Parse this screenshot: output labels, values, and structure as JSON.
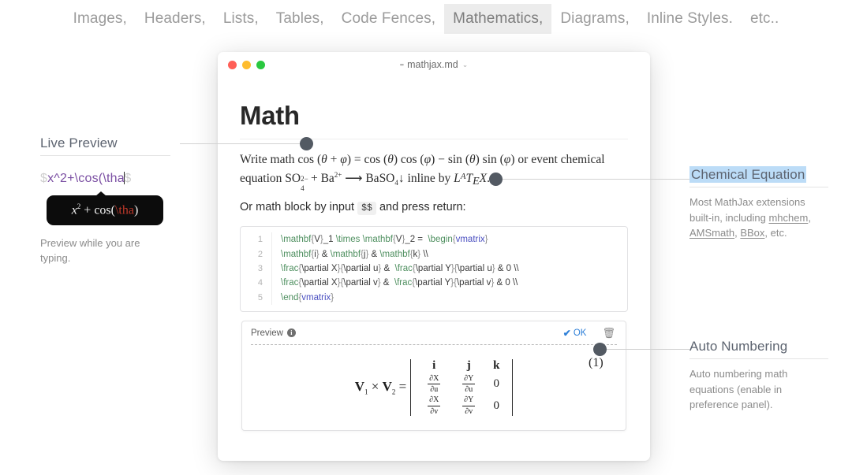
{
  "topnav": {
    "items": [
      {
        "label": "Images,",
        "active": false
      },
      {
        "label": "Headers,",
        "active": false
      },
      {
        "label": "Lists,",
        "active": false
      },
      {
        "label": "Tables,",
        "active": false
      },
      {
        "label": "Code Fences,",
        "active": false
      },
      {
        "label": "Mathematics,",
        "active": true
      },
      {
        "label": "Diagrams,",
        "active": false
      },
      {
        "label": "Inline Styles.",
        "active": false
      },
      {
        "label": "etc..",
        "active": false
      }
    ]
  },
  "window": {
    "filename": "mathjax.md",
    "file_icon": "markdown-file-icon",
    "caret_glyph": "⌄",
    "traffic_lights": [
      "close-red",
      "minimize-yellow",
      "zoom-green"
    ]
  },
  "document": {
    "heading": "Math",
    "paragraph1": {
      "lead": "Write math",
      "formula1": "cos (θ + φ) = cos (θ) cos (φ) − sin (θ) sin (φ)",
      "mid": "or event chemical equation",
      "formula2": "SO4^2- + Ba^2+ ⟶ BaSO4↓",
      "tail_a": "inline by",
      "latex": "LaTeX",
      "tail_b": "."
    },
    "paragraph2": {
      "pre": "Or math block by input",
      "badge": "$$",
      "post": "and press return:"
    },
    "code_block": {
      "language": "latex",
      "lines": [
        {
          "n": "1",
          "tokens": [
            {
              "t": "\\mathbf",
              "k": "cmd"
            },
            {
              "t": "{",
              "k": "pun"
            },
            {
              "t": "V",
              "k": "txt"
            },
            {
              "t": "}",
              "k": "pun"
            },
            {
              "t": "_1 ",
              "k": "txt"
            },
            {
              "t": "\\times",
              "k": "cmd"
            },
            {
              "t": " ",
              "k": "txt"
            },
            {
              "t": "\\mathbf",
              "k": "cmd"
            },
            {
              "t": "{",
              "k": "pun"
            },
            {
              "t": "V",
              "k": "txt"
            },
            {
              "t": "}",
              "k": "pun"
            },
            {
              "t": "_2 =  ",
              "k": "txt"
            },
            {
              "t": "\\begin",
              "k": "cmd"
            },
            {
              "t": "{",
              "k": "pun"
            },
            {
              "t": "vmatrix",
              "k": "arg"
            },
            {
              "t": "}",
              "k": "pun"
            }
          ]
        },
        {
          "n": "2",
          "tokens": [
            {
              "t": "\\mathbf",
              "k": "cmd"
            },
            {
              "t": "{",
              "k": "pun"
            },
            {
              "t": "i",
              "k": "txt"
            },
            {
              "t": "}",
              "k": "pun"
            },
            {
              "t": " & ",
              "k": "txt"
            },
            {
              "t": "\\mathbf",
              "k": "cmd"
            },
            {
              "t": "{",
              "k": "pun"
            },
            {
              "t": "j",
              "k": "txt"
            },
            {
              "t": "}",
              "k": "pun"
            },
            {
              "t": " & ",
              "k": "txt"
            },
            {
              "t": "\\mathbf",
              "k": "cmd"
            },
            {
              "t": "{",
              "k": "pun"
            },
            {
              "t": "k",
              "k": "txt"
            },
            {
              "t": "}",
              "k": "pun"
            },
            {
              "t": " \\\\",
              "k": "txt"
            }
          ]
        },
        {
          "n": "3",
          "tokens": [
            {
              "t": "\\frac",
              "k": "cmd"
            },
            {
              "t": "{",
              "k": "pun"
            },
            {
              "t": "\\partial X",
              "k": "txt"
            },
            {
              "t": "}",
              "k": "pun"
            },
            {
              "t": "{",
              "k": "pun"
            },
            {
              "t": "\\partial u",
              "k": "txt"
            },
            {
              "t": "}",
              "k": "pun"
            },
            {
              "t": " &  ",
              "k": "txt"
            },
            {
              "t": "\\frac",
              "k": "cmd"
            },
            {
              "t": "{",
              "k": "pun"
            },
            {
              "t": "\\partial Y",
              "k": "txt"
            },
            {
              "t": "}",
              "k": "pun"
            },
            {
              "t": "{",
              "k": "pun"
            },
            {
              "t": "\\partial u",
              "k": "txt"
            },
            {
              "t": "}",
              "k": "pun"
            },
            {
              "t": " & 0 \\\\",
              "k": "txt"
            }
          ]
        },
        {
          "n": "4",
          "tokens": [
            {
              "t": "\\frac",
              "k": "cmd"
            },
            {
              "t": "{",
              "k": "pun"
            },
            {
              "t": "\\partial X",
              "k": "txt"
            },
            {
              "t": "}",
              "k": "pun"
            },
            {
              "t": "{",
              "k": "pun"
            },
            {
              "t": "\\partial v",
              "k": "txt"
            },
            {
              "t": "}",
              "k": "pun"
            },
            {
              "t": " &  ",
              "k": "txt"
            },
            {
              "t": "\\frac",
              "k": "cmd"
            },
            {
              "t": "{",
              "k": "pun"
            },
            {
              "t": "\\partial Y",
              "k": "txt"
            },
            {
              "t": "}",
              "k": "pun"
            },
            {
              "t": "{",
              "k": "pun"
            },
            {
              "t": "\\partial v",
              "k": "txt"
            },
            {
              "t": "}",
              "k": "pun"
            },
            {
              "t": " & 0 \\\\",
              "k": "txt"
            }
          ]
        },
        {
          "n": "5",
          "tokens": [
            {
              "t": "\\end",
              "k": "cmd"
            },
            {
              "t": "{",
              "k": "pun"
            },
            {
              "t": "vmatrix",
              "k": "arg"
            },
            {
              "t": "}",
              "k": "pun"
            }
          ]
        }
      ]
    },
    "preview": {
      "label": "Preview",
      "info_icon": "info-icon",
      "ok_label": "OK",
      "check_icon": "check-icon",
      "trash_icon": "trash-icon",
      "equation_number": "(1)",
      "matrix": {
        "lhs": "V1 × V2 =",
        "headers": [
          "i",
          "j",
          "k"
        ],
        "rows": [
          [
            {
              "num": "∂X",
              "den": "∂u"
            },
            {
              "num": "∂Y",
              "den": "∂u"
            },
            "0"
          ],
          [
            {
              "num": "∂X",
              "den": "∂v"
            },
            {
              "num": "∂Y",
              "den": "∂v"
            },
            "0"
          ]
        ]
      }
    }
  },
  "annotations": {
    "live_preview": {
      "title": "Live Preview",
      "input_dollar_open": "$",
      "input_text": "$x^2+\\cos(\\tha",
      "input_dollar_close": "$",
      "tooltip_expr": "x² + cos(\\tha)",
      "tooltip_error_token": "\\tha",
      "caption": "Preview while you are typing."
    },
    "chemical_equation": {
      "title": "Chemical Equation",
      "body_pre": "Most MathJax extensions built-in, including ",
      "links": [
        "mhchem",
        "AMSmath",
        "BBox"
      ],
      "body_mid": ", ",
      "body_post": ", etc."
    },
    "auto_numbering": {
      "title": "Auto Numbering",
      "body": "Auto numbering math equations (enable in preference panel)."
    }
  },
  "colors": {
    "accent_blue": "#2f80d8",
    "highlight_blue": "#bcdcf7",
    "purple_math": "#7b4fa3",
    "code_cmd_green": "#4e8f5f",
    "code_arg_blue": "#4a4fc0",
    "callout_dot": "#535a63",
    "error_red": "#c0392b"
  }
}
